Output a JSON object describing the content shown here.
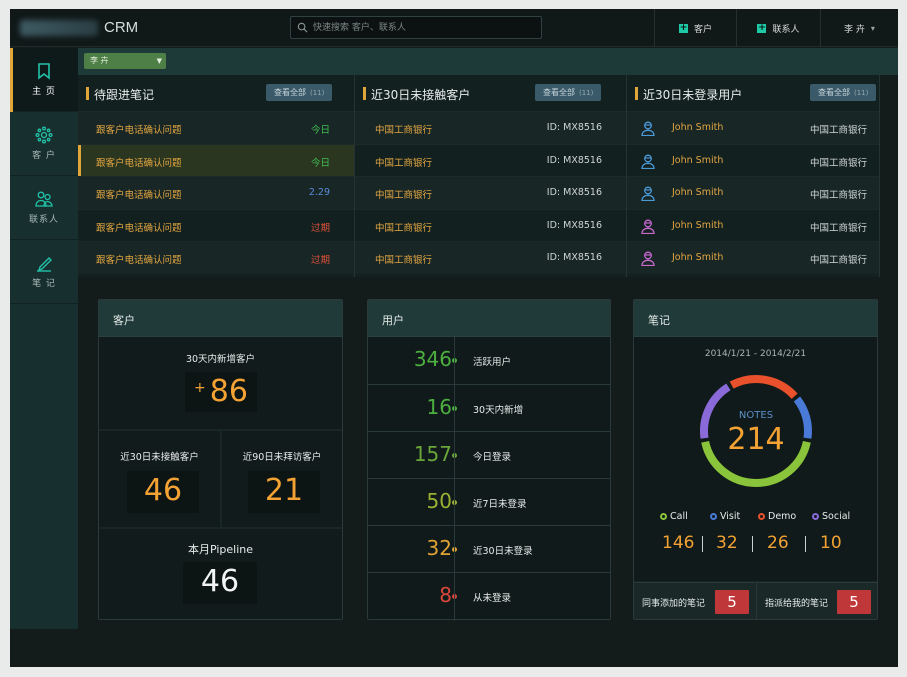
{
  "app": {
    "name": "CRM"
  },
  "search": {
    "placeholder": "快速搜索 客户、联系人"
  },
  "topbar": {
    "add_customer": "客户",
    "add_contact": "联系人",
    "user": "李 卉"
  },
  "sidebar": {
    "items": [
      {
        "label": "主 页",
        "icon": "bookmark-icon",
        "active": true
      },
      {
        "label": "客 户",
        "icon": "customers-icon"
      },
      {
        "label": "联系人",
        "icon": "contacts-icon"
      },
      {
        "label": "笔 记",
        "icon": "pencil-icon"
      }
    ]
  },
  "filter": {
    "owner": "李 卉"
  },
  "pending_notes": {
    "title": "待跟进笔记",
    "view_all": "查看全部",
    "count": "(11)",
    "rows": [
      {
        "text": "跟客户电话确认问题",
        "due": "今日",
        "color": "#3fbf52"
      },
      {
        "text": "跟客户电话确认问题",
        "due": "今日",
        "color": "#3fbf52"
      },
      {
        "text": "跟客户电话确认问题",
        "due": "2.29",
        "color": "#5a8ad8"
      },
      {
        "text": "跟客户电话确认问题",
        "due": "过期",
        "color": "#e0523a"
      },
      {
        "text": "跟客户电话确认问题",
        "due": "过期",
        "color": "#e0523a"
      }
    ]
  },
  "uncontacted": {
    "title": "近30日未接触客户",
    "view_all": "查看全部",
    "count": "(11)",
    "rows": [
      {
        "name": "中国工商银行",
        "id": "ID: MX8516"
      },
      {
        "name": "中国工商银行",
        "id": "ID: MX8516"
      },
      {
        "name": "中国工商银行",
        "id": "ID: MX8516"
      },
      {
        "name": "中国工商银行",
        "id": "ID: MX8516"
      },
      {
        "name": "中国工商银行",
        "id": "ID: MX8516"
      }
    ]
  },
  "inactive_users": {
    "title": "近30日未登录用户",
    "view_all": "查看全部",
    "count": "(11)",
    "rows": [
      {
        "name": "John Smith",
        "company": "中国工商银行",
        "avatar_color": "#4a9ad8"
      },
      {
        "name": "John Smith",
        "company": "中国工商银行",
        "avatar_color": "#4a9ad8"
      },
      {
        "name": "John Smith",
        "company": "中国工商银行",
        "avatar_color": "#4a9ad8"
      },
      {
        "name": "John Smith",
        "company": "中国工商银行",
        "avatar_color": "#c86ad0"
      },
      {
        "name": "John Smith",
        "company": "中国工商银行",
        "avatar_color": "#c86ad0"
      }
    ]
  },
  "customers_card": {
    "title": "客户",
    "new30_label": "30天内新增客户",
    "new30_prefix": "+",
    "new30": "86",
    "uncontacted30_label": "近30日未接触客户",
    "uncontacted30": "46",
    "unvisited90_label": "近90日未拜访客户",
    "unvisited90": "21",
    "pipeline_label": "本月Pipeline",
    "pipeline": "46"
  },
  "users_card": {
    "title": "用户",
    "rows": [
      {
        "value": "346",
        "label": "活跃用户",
        "color": "#4caf3f"
      },
      {
        "value": "16",
        "label": "30天内新增",
        "color": "#4caf3f"
      },
      {
        "value": "157",
        "label": "今日登录",
        "color": "#6aa53a"
      },
      {
        "value": "50",
        "label": "近7日未登录",
        "color": "#9ab033"
      },
      {
        "value": "32",
        "label": "近30日未登录",
        "color": "#e0a233"
      },
      {
        "value": "8",
        "label": "从未登录",
        "color": "#d9473a"
      }
    ]
  },
  "notes_card": {
    "title": "笔记",
    "date_range": "2014/1/21 - 2014/2/21",
    "ring_label": "NOTES",
    "total": "214",
    "legend": [
      {
        "name": "Call",
        "value": "146",
        "color": "#8ac43a"
      },
      {
        "name": "Visit",
        "value": "32",
        "color": "#4a7ad8"
      },
      {
        "name": "Demo",
        "value": "26",
        "color": "#e8512c"
      },
      {
        "name": "Social",
        "value": "10",
        "color": "#8a6ad8"
      }
    ],
    "added_by_colleagues_label": "同事添加的笔记",
    "added_by_colleagues": "5",
    "assigned_to_me_label": "指派给我的笔记",
    "assigned_to_me": "5"
  }
}
